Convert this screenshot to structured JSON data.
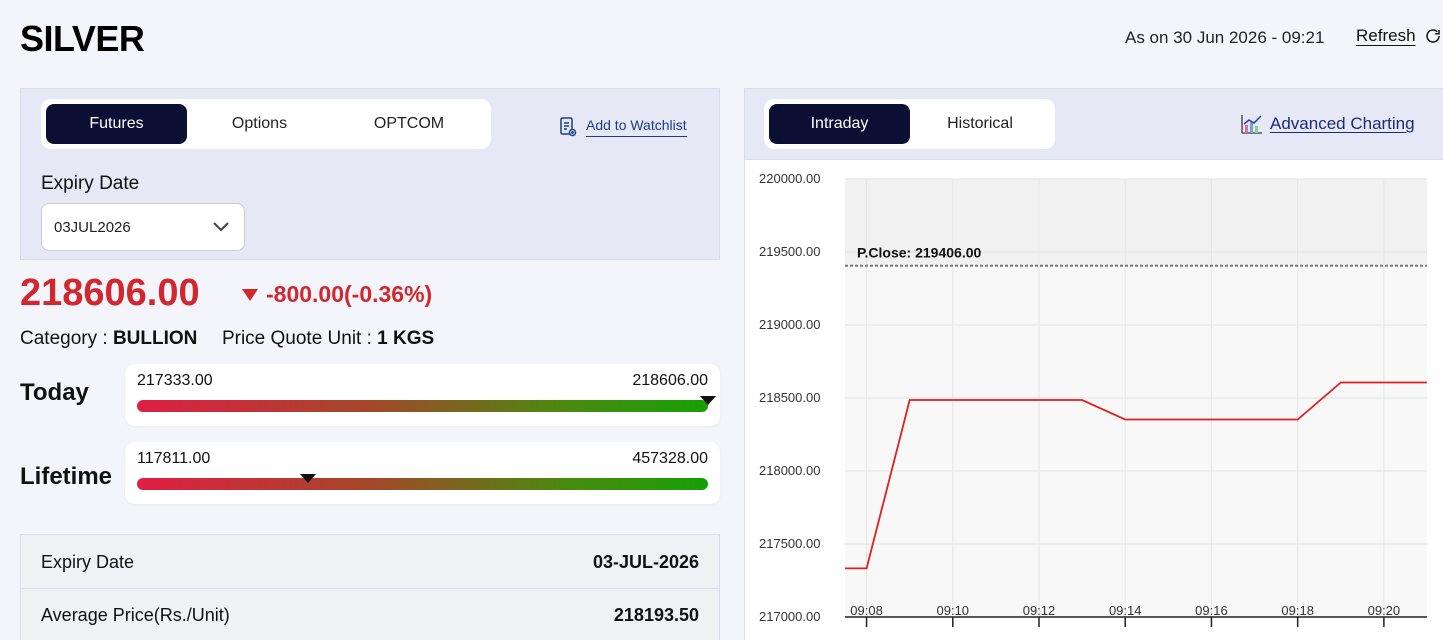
{
  "header": {
    "title": "SILVER",
    "as_on": "As on 30 Jun 2026 - 09:21",
    "refresh_label": "Refresh"
  },
  "left": {
    "tabs": [
      {
        "label": "Futures",
        "active": true
      },
      {
        "label": "Options",
        "active": false
      },
      {
        "label": "OPTCOM",
        "active": false
      }
    ],
    "watchlist_label": "Add to Watchlist",
    "expiry_label": "Expiry Date",
    "expiry_selected": "03JUL2026",
    "price": "218606.00",
    "change": "-800.00(-0.36%)",
    "category_label": "Category :",
    "category_value": "BULLION",
    "quote_unit_label": "Price Quote Unit :",
    "quote_unit_value": "1 KGS",
    "today": {
      "label": "Today",
      "low": "217333.00",
      "high": "218606.00",
      "position": 1.0
    },
    "lifetime": {
      "label": "Lifetime",
      "low": "117811.00",
      "high": "457328.00",
      "position": 0.3
    },
    "details": [
      {
        "label": "Expiry Date",
        "value": "03-JUL-2026"
      },
      {
        "label": "Average Price(Rs./Unit)",
        "value": "218193.50"
      }
    ]
  },
  "right": {
    "tabs": [
      {
        "label": "Intraday",
        "active": true
      },
      {
        "label": "Historical",
        "active": false
      }
    ],
    "advanced_label": "Advanced Charting"
  },
  "colors": {
    "accent_dark": "#0b0f33",
    "price_down": "#d3272f",
    "link": "#1b3e86"
  },
  "chart_data": {
    "type": "line",
    "x": [
      "09:07.5",
      "09:08",
      "09:09",
      "09:10",
      "09:11",
      "09:12",
      "09:13",
      "09:14",
      "09:15",
      "09:16",
      "09:17",
      "09:18",
      "09:19",
      "09:20",
      "09:21"
    ],
    "series": [
      {
        "values": [
          217333,
          217333,
          218486,
          218486,
          218486,
          218486,
          218486,
          218353,
          218353,
          218353,
          218353,
          218353,
          218606,
          218606,
          218606
        ]
      }
    ],
    "x_tick_labels": [
      "09:08",
      "09:10",
      "09:12",
      "09:14",
      "09:16",
      "09:18",
      "09:20"
    ],
    "y_tick_labels": [
      "220000.00",
      "219500.00",
      "219000.00",
      "218500.00",
      "218000.00",
      "217500.00",
      "217000.00"
    ],
    "ylim": [
      217000,
      220000
    ],
    "reference_line": {
      "label": "P.Close: 219406.00",
      "value": 219406
    },
    "grid": true
  }
}
